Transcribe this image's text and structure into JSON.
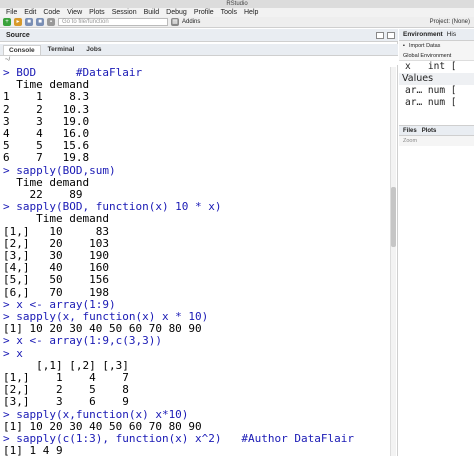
{
  "window": {
    "title": "RStudio"
  },
  "menu": [
    "File",
    "Edit",
    "Code",
    "View",
    "Plots",
    "Session",
    "Build",
    "Debug",
    "Profile",
    "Tools",
    "Help"
  ],
  "toolbar": {
    "goto_placeholder": "Go to file/function",
    "addins": "Addins",
    "project": "Project: (None)"
  },
  "source": {
    "title": "Source"
  },
  "console_tabs": [
    "Console",
    "Terminal",
    "Jobs"
  ],
  "console_path": "~/",
  "console_lines": [
    {
      "type": "cmd",
      "text": "> BOD      #DataFlair"
    },
    {
      "type": "out",
      "text": "  Time demand"
    },
    {
      "type": "out",
      "text": "1    1    8.3"
    },
    {
      "type": "out",
      "text": "2    2   10.3"
    },
    {
      "type": "out",
      "text": "3    3   19.0"
    },
    {
      "type": "out",
      "text": "4    4   16.0"
    },
    {
      "type": "out",
      "text": "5    5   15.6"
    },
    {
      "type": "out",
      "text": "6    7   19.8"
    },
    {
      "type": "cmd",
      "text": "> sapply(BOD,sum)"
    },
    {
      "type": "out",
      "text": "  Time demand"
    },
    {
      "type": "out",
      "text": "    22    89"
    },
    {
      "type": "cmd",
      "text": "> sapply(BOD, function(x) 10 * x)"
    },
    {
      "type": "out",
      "text": "     Time demand"
    },
    {
      "type": "out",
      "text": "[1,]   10     83"
    },
    {
      "type": "out",
      "text": "[2,]   20    103"
    },
    {
      "type": "out",
      "text": "[3,]   30    190"
    },
    {
      "type": "out",
      "text": "[4,]   40    160"
    },
    {
      "type": "out",
      "text": "[5,]   50    156"
    },
    {
      "type": "out",
      "text": "[6,]   70    198"
    },
    {
      "type": "cmd",
      "text": "> x <- array(1:9)"
    },
    {
      "type": "cmd",
      "text": "> sapply(x, function(x) x * 10)"
    },
    {
      "type": "out",
      "text": "[1] 10 20 30 40 50 60 70 80 90"
    },
    {
      "type": "cmd",
      "text": "> x <- array(1:9,c(3,3))"
    },
    {
      "type": "cmd",
      "text": "> x"
    },
    {
      "type": "out",
      "text": "     [,1] [,2] [,3]"
    },
    {
      "type": "out",
      "text": "[1,]    1    4    7"
    },
    {
      "type": "out",
      "text": "[2,]    2    5    8"
    },
    {
      "type": "out",
      "text": "[3,]    3    6    9"
    },
    {
      "type": "cmd",
      "text": "> sapply(x,function(x) x*10)"
    },
    {
      "type": "out",
      "text": "[1] 10 20 30 40 50 60 70 80 90"
    },
    {
      "type": "cmd",
      "text": "> sapply(c(1:3), function(x) x^2)   #Author DataFlair"
    },
    {
      "type": "out",
      "text": "[1] 1 4 9"
    }
  ],
  "environment": {
    "tabs": [
      "Environment",
      "His"
    ],
    "import_label": "Import Datas",
    "scope": "Global Environment",
    "row1": "x   int [",
    "section": "Values",
    "row2": "ar… num [",
    "row3": "ar… num ["
  },
  "files": {
    "tabs": [
      "Files",
      "Plots"
    ],
    "zoom": "Zoom"
  }
}
